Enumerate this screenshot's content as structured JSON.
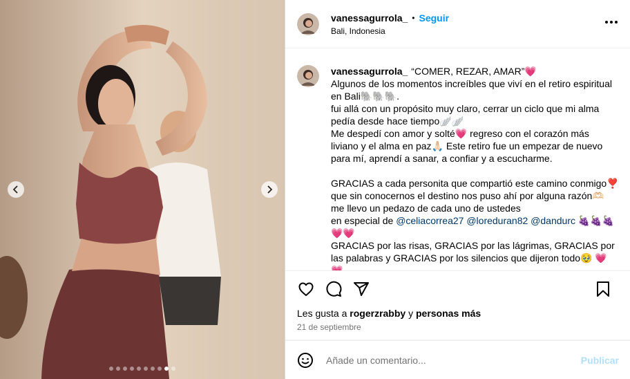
{
  "header": {
    "username": "vanessagurrola_",
    "separator": "•",
    "follow_label": "Seguir",
    "location": "Bali, Indonesia"
  },
  "caption": {
    "username": "vanessagurrola_",
    "title": "“COMER, REZAR, AMAR”💗",
    "lines": [
      "Algunos de los momentos increíbles que viví en el retiro espiritual en Bali🐘🐘🐘.",
      "fui allá con un propósito muy claro, cerrar un ciclo que mi alma pedía desde hace tiempo🪽🪽",
      "Me despedí con amor y solté💗 regreso con el corazón más liviano y el alma en paz🙏🏻 Este retiro fue un empezar de nuevo para mí, aprendí a sanar, a confiar y a escucharme.",
      "GRACIAS a cada personita que compartió este camino conmigo❣️ que sin conocernos el destino nos puso ahí por alguna razón🫶🏻 me llevo un pedazo de cada uno de ustedes",
      "GRACIAS por las risas, GRACIAS por las lágrimas, GRACIAS por las palabras y GRACIAS por los silencios que dijeron todo🥹 💗💗"
    ],
    "mentions_prefix": "en especial de",
    "mentions": [
      "@celiacorrea27",
      "@loreduran82",
      "@dandurc"
    ],
    "mentions_suffix": "🍇🍇🍇 💗💗"
  },
  "actions": {
    "like_icon": "heart-outline-icon",
    "comment_icon": "comment-icon",
    "share_icon": "send-icon",
    "save_icon": "bookmark-icon"
  },
  "likes": {
    "prefix": "Les gusta a",
    "user": "rogerzrabby",
    "conjunction": "y",
    "others": "personas más"
  },
  "date": "21 de septiembre",
  "comment": {
    "placeholder": "Añade un comentario...",
    "publish_label": "Publicar"
  },
  "carousel": {
    "total_slides": 10,
    "active_index": 8
  },
  "colors": {
    "accent": "#0095f6",
    "publish_disabled": "#b2dffc",
    "mention": "#00376b",
    "heart": "#ed4956"
  }
}
